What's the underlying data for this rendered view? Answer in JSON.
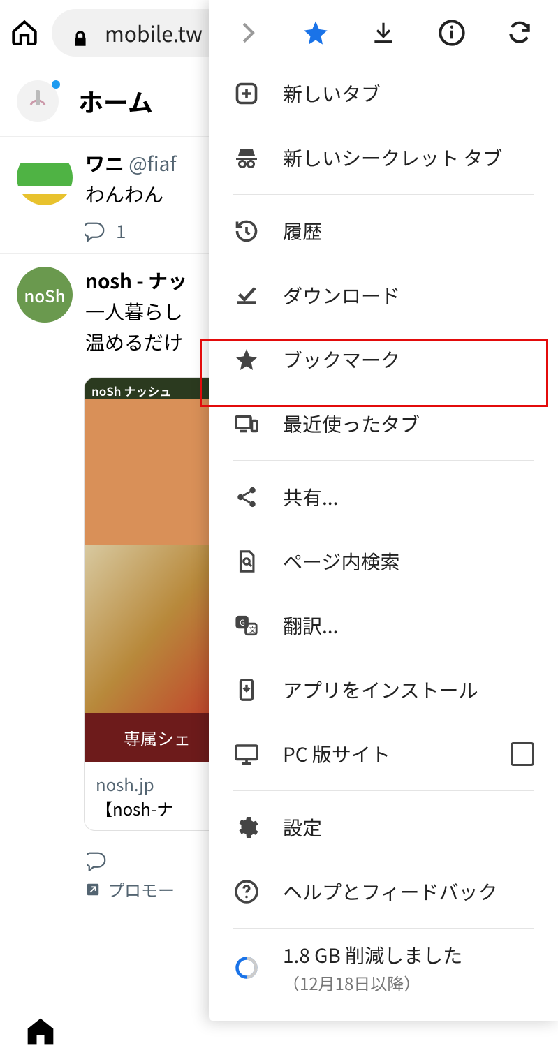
{
  "topbar": {
    "url": "mobile.tw"
  },
  "feed": {
    "title": "ホーム",
    "tweets": [
      {
        "name": "ワニ",
        "handle": "@fiaf",
        "text": "わんわん",
        "reply_count": "1"
      },
      {
        "name": "nosh - ナッ",
        "line1": "一人暮らし",
        "line2": "温めるだけ",
        "card": {
          "band": "専属シェ",
          "domain": "nosh.jp",
          "title": "【nosh-ナ"
        }
      }
    ],
    "promoted_label": "プロモー"
  },
  "menu": {
    "new_tab": "新しいタブ",
    "incognito": "新しいシークレット タブ",
    "history": "履歴",
    "downloads": "ダウンロード",
    "bookmarks": "ブックマーク",
    "recent_tabs": "最近使ったタブ",
    "share": "共有...",
    "find": "ページ内検索",
    "translate": "翻訳...",
    "install": "アプリをインストール",
    "desktop": "PC 版サイト",
    "settings": "設定",
    "help": "ヘルプとフィードバック",
    "data_saver": "1.8 GB 削減しました",
    "data_saver_sub": "（12月18日以降）"
  }
}
